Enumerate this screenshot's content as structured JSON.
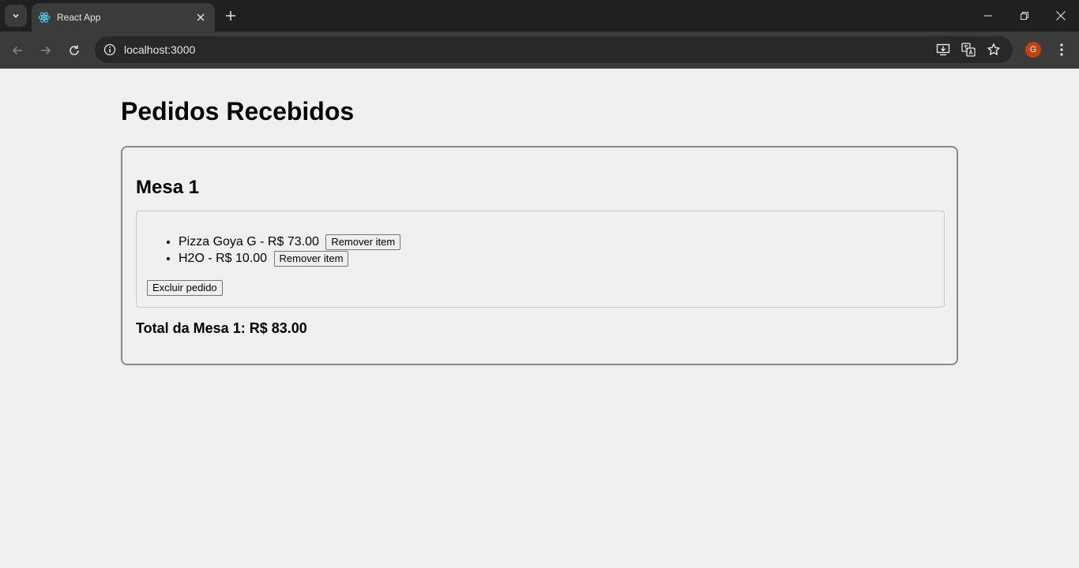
{
  "browser": {
    "tab_title": "React App",
    "url": "localhost:3000",
    "profile_initial": "G",
    "colors": {
      "titlebar": "#1f2020",
      "toolbar": "#3b3b3b",
      "avatar": "#c2410c"
    }
  },
  "page": {
    "title": "Pedidos Recebidos",
    "order": {
      "table_title": "Mesa 1",
      "items": [
        {
          "text": "Pizza Goya G - R$ 73.00",
          "remove_label": "Remover item"
        },
        {
          "text": "H2O - R$ 10.00",
          "remove_label": "Remover item"
        }
      ],
      "delete_label": "Excluir pedido",
      "total_text": "Total da Mesa 1: R$ 83.00"
    }
  },
  "icons": [
    "chevron-down-icon",
    "react-icon",
    "close-icon",
    "plus-icon",
    "minimize-icon",
    "restore-icon",
    "back-icon",
    "forward-icon",
    "reload-icon",
    "info-icon",
    "install-icon",
    "translate-icon",
    "star-icon",
    "kebab-menu-icon"
  ]
}
